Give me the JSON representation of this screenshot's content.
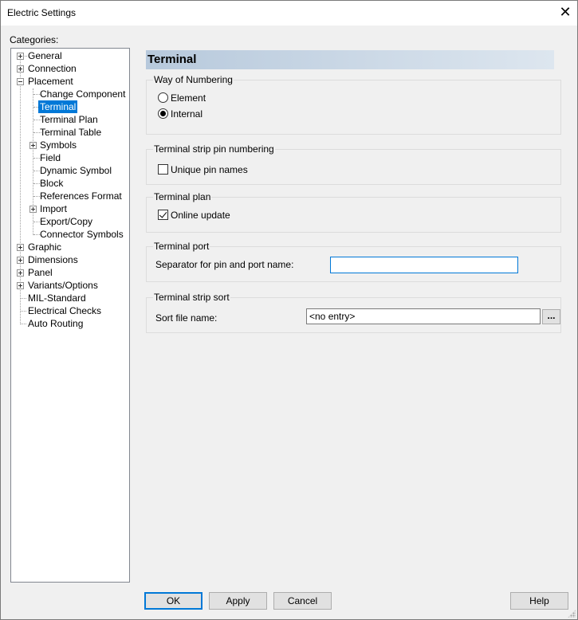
{
  "window": {
    "title": "Electric Settings",
    "close_glyph": "✕"
  },
  "tree": {
    "label": "Categories:",
    "items": [
      {
        "label": "General"
      },
      {
        "label": "Connection"
      },
      {
        "label": "Placement"
      },
      {
        "label": "Change Component"
      },
      {
        "label": "Terminal"
      },
      {
        "label": "Terminal Plan"
      },
      {
        "label": "Terminal Table"
      },
      {
        "label": "Symbols"
      },
      {
        "label": "Field"
      },
      {
        "label": "Dynamic Symbol"
      },
      {
        "label": "Block"
      },
      {
        "label": "References Format"
      },
      {
        "label": "Import"
      },
      {
        "label": "Export/Copy"
      },
      {
        "label": "Connector Symbols"
      },
      {
        "label": "Graphic"
      },
      {
        "label": "Dimensions"
      },
      {
        "label": "Panel"
      },
      {
        "label": "Variants/Options"
      },
      {
        "label": "MIL-Standard"
      },
      {
        "label": "Electrical Checks"
      },
      {
        "label": "Auto Routing"
      }
    ],
    "selected": "Terminal"
  },
  "panel": {
    "title": "Terminal",
    "numbering": {
      "title": "Way of Numbering",
      "options": [
        "Element",
        "Internal"
      ],
      "selected": "Internal"
    },
    "strip_pin": {
      "title": "Terminal strip pin numbering",
      "unique_label": "Unique pin names",
      "unique_checked": false
    },
    "plan": {
      "title": "Terminal plan",
      "online_label": "Online update",
      "online_checked": true
    },
    "port": {
      "title": "Terminal port",
      "separator_label": "Separator for pin and port name:",
      "separator_value": ""
    },
    "sort": {
      "title": "Terminal strip sort",
      "file_label": "Sort file name:",
      "file_value": "<no entry>",
      "browse_label": "..."
    }
  },
  "buttons": {
    "ok": "OK",
    "apply": "Apply",
    "cancel": "Cancel",
    "help": "Help"
  }
}
